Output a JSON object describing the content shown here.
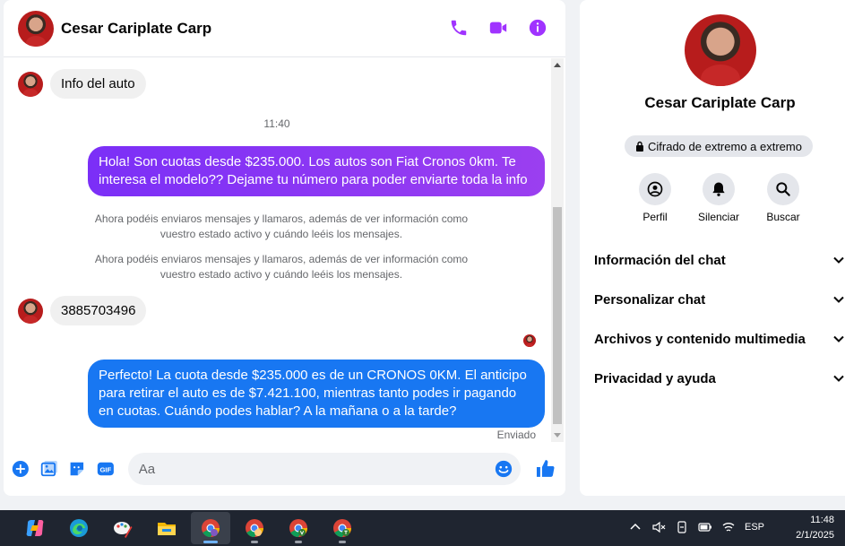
{
  "chat": {
    "contact_name": "Cesar Cariplate Carp",
    "header_icons": [
      "phone-icon",
      "video-icon",
      "info-icon"
    ],
    "messages": {
      "in1": "Info del auto",
      "time": "11:40",
      "out1": "Hola! Son cuotas desde $235.000. Los autos son Fiat Cronos 0km. Te interesa el modelo?? Dejame tu número para poder enviarte toda la info",
      "notice": "Ahora podéis enviaros mensajes y llamaros, además de ver información como vuestro estado activo y cuándo leéis los mensajes.",
      "in2": "3885703496",
      "out2": "Perfecto! La cuota desde $235.000 es de un CRONOS 0KM. El anticipo para retirar el auto es de $7.421.100, mientras tanto podes ir pagando en cuotas. Cuándo podes hablar? A la mañana o a la tarde?",
      "status": "Enviado"
    },
    "composer": {
      "placeholder": "Aa",
      "value": "",
      "icons": [
        "plus-icon",
        "image-icon",
        "sticker-icon",
        "gif-icon",
        "emoji-icon",
        "like-icon"
      ]
    },
    "colors": {
      "accent": "#a033ff",
      "outgoing": "#1877f2"
    }
  },
  "info": {
    "name": "Cesar Cariplate Carp",
    "encryption": "Cifrado de extremo a extremo",
    "actions": [
      {
        "label": "Perfil",
        "icon": "profile-icon"
      },
      {
        "label": "Silenciar",
        "icon": "bell-icon"
      },
      {
        "label": "Buscar",
        "icon": "search-icon"
      }
    ],
    "sections": [
      "Información del chat",
      "Personalizar chat",
      "Archivos y contenido multimedia",
      "Privacidad y ayuda"
    ]
  },
  "taskbar": {
    "apps": [
      "copilot-icon",
      "edge-icon",
      "paint-icon",
      "file-explorer-icon",
      "chrome-icon",
      "chrome-profile-icon",
      "chrome-profile-v-icon",
      "chrome-profile-t-icon"
    ],
    "language": "ESP",
    "time": "11:48",
    "date": "2/1/2025"
  }
}
